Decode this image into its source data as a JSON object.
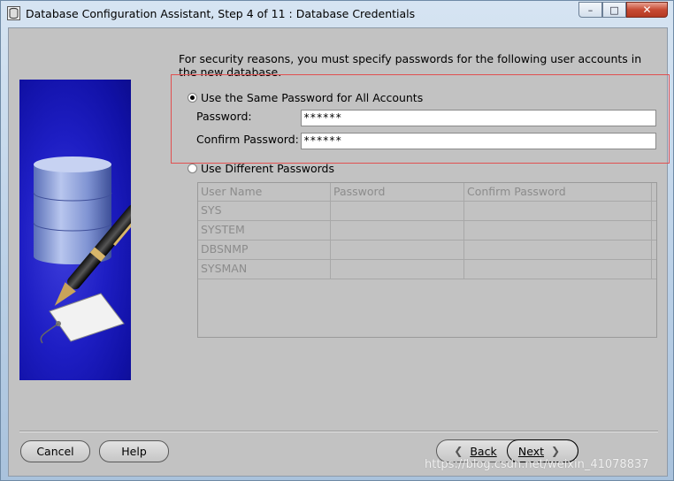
{
  "window": {
    "title": "Database Configuration Assistant, Step 4 of 11 : Database Credentials",
    "controls": {
      "minimize": "–",
      "maximize": "□",
      "close": "✕"
    }
  },
  "intro_text": "For security reasons, you must specify passwords for the following user accounts in the new database.",
  "same_password": {
    "option_label": "Use the Same Password for All Accounts",
    "selected": true,
    "password_label": "Password:",
    "password_value": "******",
    "confirm_label": "Confirm Password:",
    "confirm_value": "******"
  },
  "different_passwords": {
    "option_label": "Use Different Passwords",
    "selected": false,
    "columns": [
      "User Name",
      "Password",
      "Confirm Password"
    ],
    "rows": [
      [
        "SYS",
        "",
        ""
      ],
      [
        "SYSTEM",
        "",
        ""
      ],
      [
        "DBSNMP",
        "",
        ""
      ],
      [
        "SYSMAN",
        "",
        ""
      ]
    ]
  },
  "buttons": {
    "cancel": "Cancel",
    "help": "Help",
    "back_prefix": "",
    "back": "Back",
    "next": "Next"
  },
  "watermark": "https://blog.csdn.net/weixin_41078837",
  "colors": {
    "highlight_box": "#e05050",
    "side_panel": "#1e1ec4"
  }
}
